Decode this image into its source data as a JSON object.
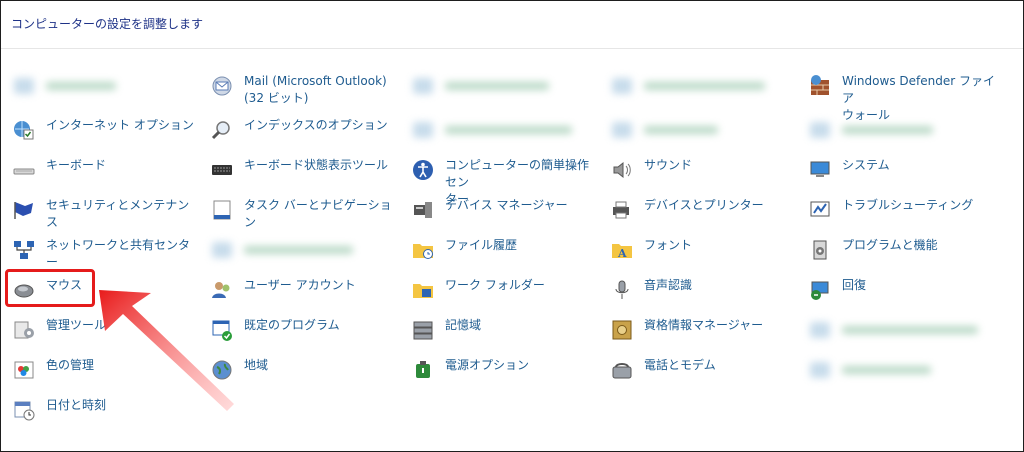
{
  "header": {
    "title": "コンピューターの設定を調整します"
  },
  "columns": [
    [
      {
        "label": "",
        "icon": "blurred-icon",
        "blurred": true
      },
      {
        "label": "インターネット オプション",
        "icon": "globe-check-icon"
      },
      {
        "label": "キーボード",
        "icon": "keyboard-icon"
      },
      {
        "label": "セキュリティとメンテナンス",
        "icon": "flag-icon"
      },
      {
        "label": "ネットワークと共有センター",
        "icon": "network-icon"
      },
      {
        "label": "マウス",
        "icon": "mouse-icon"
      },
      {
        "label": "管理ツール",
        "icon": "admin-tools-icon"
      },
      {
        "label": "色の管理",
        "icon": "color-management-icon"
      },
      {
        "label": "日付と時刻",
        "icon": "calendar-clock-icon"
      }
    ],
    [
      {
        "label": "Mail (Microsoft Outlook)\n(32 ビット)",
        "icon": "mail-icon"
      },
      {
        "label": "インデックスのオプション",
        "icon": "magnifier-icon"
      },
      {
        "label": "キーボード状態表示ツール",
        "icon": "keyboard-status-icon"
      },
      {
        "label": "タスク バーとナビゲーション",
        "icon": "taskbar-icon"
      },
      {
        "label": "",
        "icon": "blurred-icon",
        "blurred": true
      },
      {
        "label": "ユーザー アカウント",
        "icon": "users-icon"
      },
      {
        "label": "既定のプログラム",
        "icon": "default-programs-icon"
      },
      {
        "label": "地域",
        "icon": "region-icon"
      }
    ],
    [
      {
        "label": "",
        "icon": "blurred-icon",
        "blurred": true
      },
      {
        "label": "",
        "icon": "blurred-icon",
        "blurred": true
      },
      {
        "label": "コンピューターの簡単操作セン\nター",
        "icon": "ease-of-access-icon"
      },
      {
        "label": "デバイス マネージャー",
        "icon": "device-manager-icon"
      },
      {
        "label": "ファイル履歴",
        "icon": "folder-history-icon"
      },
      {
        "label": "ワーク フォルダー",
        "icon": "work-folders-icon"
      },
      {
        "label": "記憶域",
        "icon": "storage-icon"
      },
      {
        "label": "電源オプション",
        "icon": "power-icon"
      }
    ],
    [
      {
        "label": "",
        "icon": "blurred-icon",
        "blurred": true
      },
      {
        "label": "",
        "icon": "blurred-icon",
        "blurred": true
      },
      {
        "label": "サウンド",
        "icon": "speaker-icon"
      },
      {
        "label": "デバイスとプリンター",
        "icon": "printer-icon"
      },
      {
        "label": "フォント",
        "icon": "fonts-folder-icon"
      },
      {
        "label": "音声認識",
        "icon": "microphone-icon"
      },
      {
        "label": "資格情報マネージャー",
        "icon": "credential-vault-icon"
      },
      {
        "label": "電話とモデム",
        "icon": "phone-modem-icon"
      }
    ],
    [
      {
        "label": "Windows Defender ファイア\nウォール",
        "icon": "firewall-icon"
      },
      {
        "label": "",
        "icon": "blurred-icon",
        "blurred": true
      },
      {
        "label": "システム",
        "icon": "monitor-icon"
      },
      {
        "label": "トラブルシューティング",
        "icon": "troubleshoot-icon"
      },
      {
        "label": "プログラムと機能",
        "icon": "programs-features-icon"
      },
      {
        "label": "回復",
        "icon": "recovery-icon"
      },
      {
        "label": "",
        "icon": "blurred-icon",
        "blurred": true
      },
      {
        "label": "",
        "icon": "blurred-icon",
        "blurred": true
      }
    ]
  ],
  "colors": {
    "link": "#1e5b8f",
    "header": "#1e3287",
    "highlight": "#e51b1b"
  }
}
